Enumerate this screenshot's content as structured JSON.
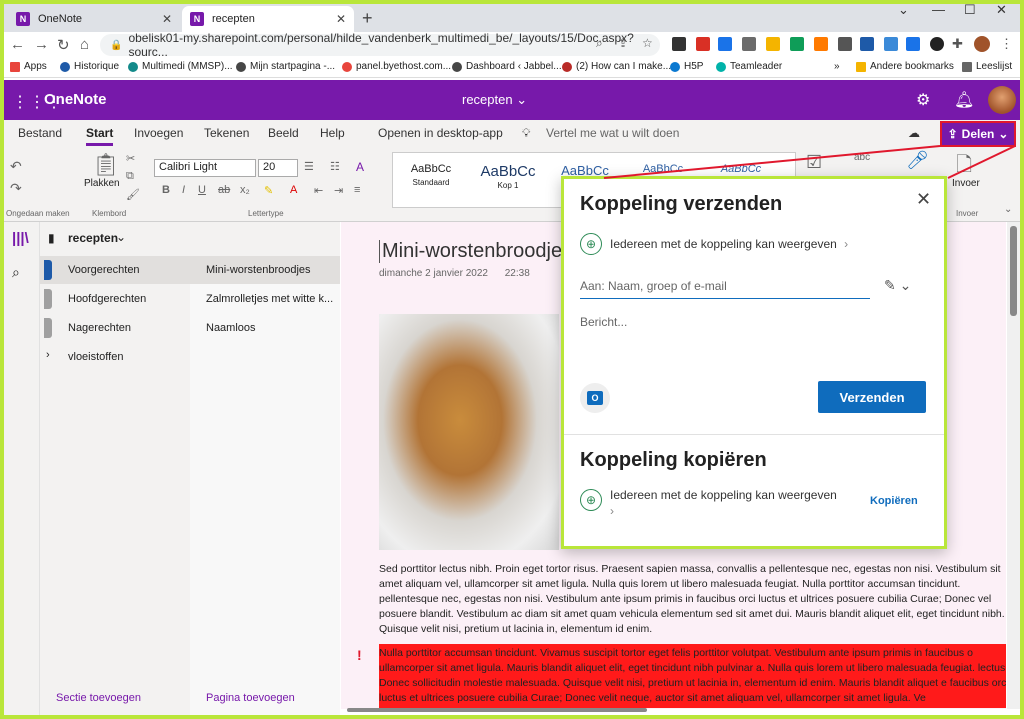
{
  "browser": {
    "tabs": [
      {
        "title": "OneNote",
        "favicon": "N"
      },
      {
        "title": "recepten",
        "favicon": "N"
      }
    ],
    "new_tab": "+",
    "url": "obelisk01-my.sharepoint.com/personal/hilde_vandenberk_multimedi_be/_layouts/15/Doc.aspx?sourc...",
    "bookmarks": [
      "Apps",
      "Historique",
      "Multimedi (MMSP)...",
      "Mijn startpagina -...",
      "panel.byethost.com...",
      "Dashboard ‹ Jabbel...",
      "(2) How can I make...",
      "H5P",
      "Teamleader"
    ],
    "more_bookmarks": "»",
    "other_bookmarks": "Andere bookmarks",
    "reading_list": "Leeslijst"
  },
  "header": {
    "app_name": "OneNote",
    "doc_title": "recepten ⌄"
  },
  "ribbon": {
    "tabs": [
      "Bestand",
      "Start",
      "Invoegen",
      "Tekenen",
      "Beeld",
      "Help"
    ],
    "open_desktop": "Openen in desktop-app",
    "tell_me": "Vertel me wat u wilt doen",
    "share_label": "Delen",
    "undo_group": "Ongedaan maken",
    "clipboard_group": "Klembord",
    "paste_label": "Plakken",
    "font_group": "Lettertype",
    "font_name": "Calibri Light",
    "font_size": "20",
    "styles": [
      {
        "sample": "AaBbCc",
        "name": "Standaard"
      },
      {
        "sample": "AaBbCc",
        "name": "Kop 1"
      },
      {
        "sample": "AaBbCc",
        "name": ""
      },
      {
        "sample": "AaBbCc",
        "name": ""
      },
      {
        "sample": "AaBbCc",
        "name": ""
      }
    ],
    "insert_label": "Invoer",
    "insert_group": "Invoer"
  },
  "notebook": {
    "name": "recepten",
    "sections": [
      {
        "label": "Voorgerechten",
        "color": "#1e5aa8"
      },
      {
        "label": "Hoofdgerechten",
        "color": "#a0a0a0"
      },
      {
        "label": "Nagerechten",
        "color": "#a0a0a0"
      },
      {
        "label": "vloeistoffen",
        "color": ""
      }
    ],
    "pages": [
      "Mini-worstenbroodjes",
      "Zalmrolletjes met witte k...",
      "Naamloos"
    ],
    "add_section": "Sectie toevoegen",
    "add_page": "Pagina toevoegen"
  },
  "page": {
    "title": "Mini-worstenbroodje",
    "date": "dimanche 2 janvier 2022",
    "time": "22:38",
    "body": "Sed porttitor lectus nibh. Proin eget tortor risus. Praesent sapien massa, convallis a pellentesque nec, egestas non nisi. Vestibulum sit amet aliquam vel, ullamcorper sit amet ligula. Nulla quis lorem ut libero malesuada feugiat. Nulla porttitor accumsan tincidunt. pellentesque nec, egestas non nisi. Vestibulum ante ipsum primis in faucibus orci luctus et ultrices posuere cubilia Curae; Donec vel posuere blandit. Vestibulum ac diam sit amet quam vehicula elementum sed sit amet dui. Mauris blandit aliquet elit, eget tincidunt nibh. Quisque velit nisi, pretium ut lacinia in, elementum id enim.",
    "highlighted": "Nulla porttitor accumsan tincidunt. Vivamus suscipit tortor eget felis porttitor volutpat. Vestibulum ante ipsum primis in faucibus o ullamcorper sit amet ligula. Mauris blandit aliquet elit, eget tincidunt nibh pulvinar a. Nulla quis lorem ut libero malesuada feugiat. lectus. Donec sollicitudin molestie malesuada. Quisque velit nisi, pretium ut lacinia in, elementum id enim. Mauris blandit aliquet e faucibus orci luctus et ultrices posuere cubilia Curae; Donec velit neque, auctor sit amet aliquam vel, ullamcorper sit amet ligula. Ve",
    "flag": "!"
  },
  "share_dialog": {
    "send_title": "Koppeling verzenden",
    "permission": "Iedereen met de koppeling kan weergeven",
    "to_placeholder": "Aan: Naam, groep of e-mail",
    "message_placeholder": "Bericht...",
    "send_button": "Verzenden",
    "copy_title": "Koppeling kopiëren",
    "copy_permission": "Iedereen met de koppeling kan weergeven",
    "copy_button": "Kopiëren"
  },
  "colors": {
    "onenote_purple": "#7719aa",
    "highlight_frame": "#b9e63a",
    "annotation_red": "#e0182d",
    "link_blue": "#0f6cbd"
  }
}
